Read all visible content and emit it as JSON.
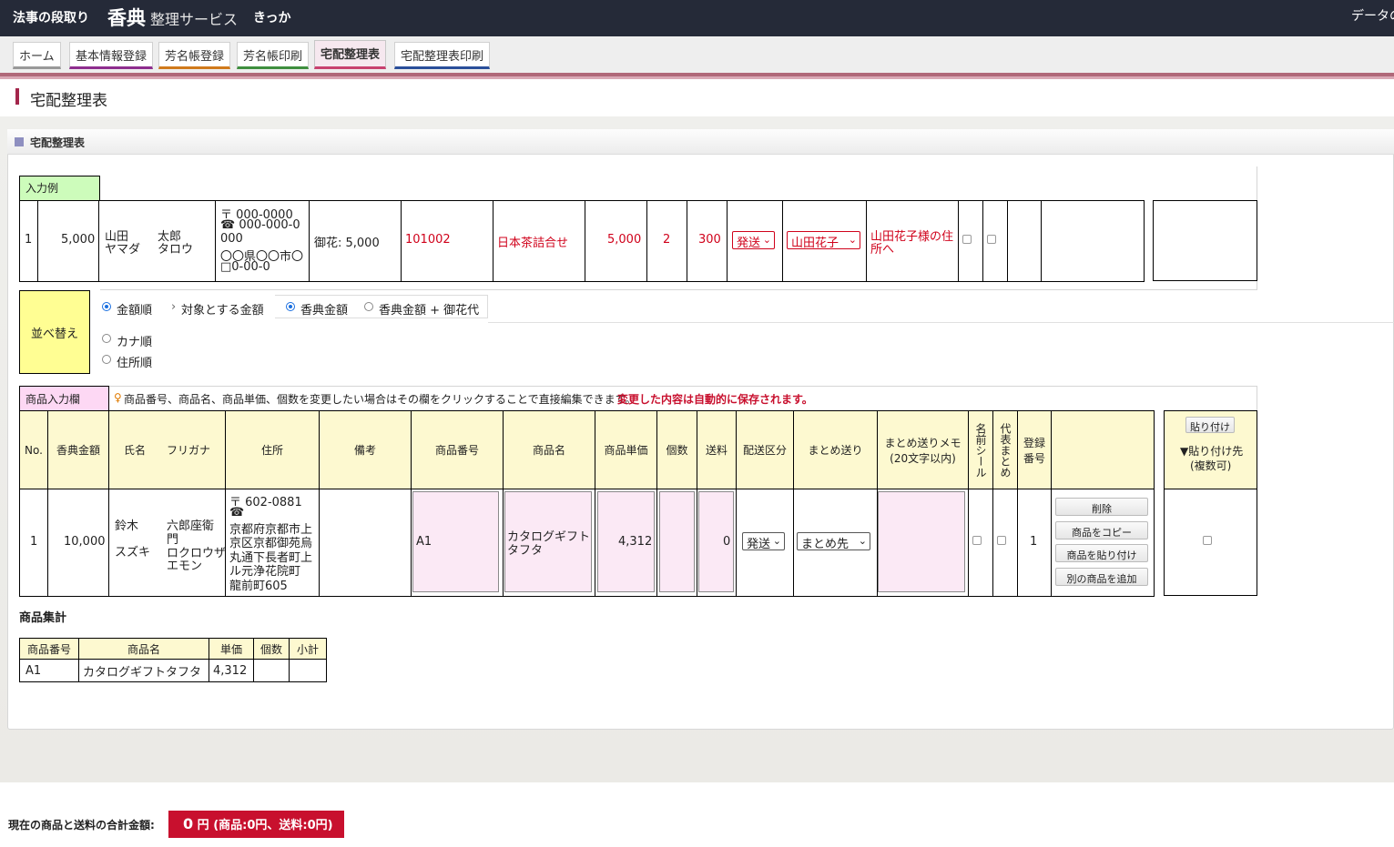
{
  "header": {
    "brand_left": "法事の段取り",
    "brand_main": "香典",
    "brand_sub": "整理サービス",
    "brand_right": "きっか",
    "right_text": "データの"
  },
  "tabs": [
    {
      "label": "ホーム",
      "color": "#999999"
    },
    {
      "label": "基本情報登録",
      "color": "#8e2e8e"
    },
    {
      "label": "芳名帳登録",
      "color": "#d07a1c"
    },
    {
      "label": "芳名帳印刷",
      "color": "#3f8f3f"
    },
    {
      "label": "宅配整理表",
      "color": "#c8416f"
    },
    {
      "label": "宅配整理表印刷",
      "color": "#2a4f9a"
    }
  ],
  "page_title": "宅配整理表",
  "panel_title": "宅配整理表",
  "example": {
    "label": "入力例",
    "no": "1",
    "amount": "5,000",
    "surname": "山田",
    "given": "太郎",
    "surname_kana": "ヤマダ",
    "given_kana": "タロウ",
    "postal": "〒 000-0000",
    "phone": "☎ 000-000-0",
    "phone_cont": "000",
    "address1": "〇〇県〇〇市〇",
    "address2": "□0-00-0",
    "note": "御花: 5,000",
    "product_no": "101002",
    "product_name": "日本茶詰合せ",
    "unit_price": "5,000",
    "qty": "2",
    "shipping": "300",
    "delivery_type": "発送",
    "bundle_to": "山田花子",
    "memo_line1": "山田花子様の住",
    "memo_line2": "所へ"
  },
  "sort": {
    "label": "並べ替え",
    "options": [
      "金額順",
      "カナ順",
      "住所順"
    ],
    "selected": "金額順",
    "target_label": "対象とする金額",
    "target_options": [
      "香典金額",
      "香典金額 + 御花代"
    ],
    "target_selected": "香典金額"
  },
  "product_input": {
    "label": "商品入力欄",
    "hint": "商品番号、商品名、商品単価、個数を変更したい場合はその欄をクリックすることで直接編集できます。",
    "hint_red": "変更した内容は自動的に保存されます。"
  },
  "columns": {
    "no": "No.",
    "amount": "香典金額",
    "name": "氏名",
    "kana": "フリガナ",
    "address": "住所",
    "note": "備考",
    "product_no": "商品番号",
    "product_name": "商品名",
    "unit_price": "商品単価",
    "qty": "個数",
    "shipping": "送料",
    "delivery_type": "配送区分",
    "bundle": "まとめ送り",
    "memo1": "まとめ送りメモ",
    "memo2": "(20文字以内)",
    "name_seal": "名前シール",
    "rep_bundle": "代表まとめ",
    "reg1": "登録",
    "reg2": "番号",
    "paste_button": "貼り付け",
    "paste_target1": "▼貼り付け先",
    "paste_target2": "(複数可)"
  },
  "row": {
    "no": "1",
    "amount": "10,000",
    "surname": "鈴木",
    "given_line1": "六郎座衛",
    "given_line2": "門",
    "surname_kana": "スズキ",
    "given_kana_line1": "ロクロウザ",
    "given_kana_line2": "エモン",
    "postal": "〒 602-0881",
    "phone": "☎",
    "address_lines": [
      "京都府京都市上",
      "京区京都御苑烏",
      "丸通下長者町上",
      "ル元浄花院町",
      "龍前町605"
    ],
    "product_no": "A1",
    "product_name_line1": "カタログギフト",
    "product_name_line2": "タフタ",
    "unit_price": "4,312",
    "qty": "",
    "shipping": "0",
    "delivery_type": "発送",
    "bundle": "まとめ先",
    "reg_no": "1",
    "buttons": [
      "削除",
      "商品をコピー",
      "商品を貼り付け",
      "別の商品を追加"
    ]
  },
  "summary": {
    "title": "商品集計",
    "headers": [
      "商品番号",
      "商品名",
      "単価",
      "個数",
      "小計"
    ],
    "rows": [
      [
        "A1",
        "カタログギフトタフタ",
        "4,312",
        "",
        ""
      ]
    ]
  },
  "footer": {
    "label": "現在の商品と送料の合計金額:",
    "total": "0",
    "unit": "円",
    "detail": "(商品:0円、送料:0円)"
  },
  "colors": {
    "header_bg": "#252a38",
    "accent": "#c8102e",
    "active_tab": "#c8416f"
  }
}
